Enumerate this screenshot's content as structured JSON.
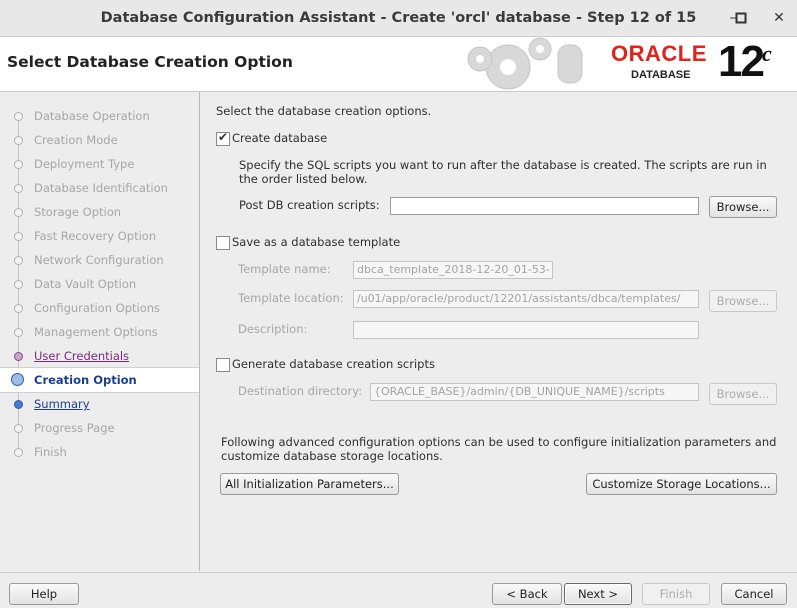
{
  "window": {
    "title": "Database Configuration Assistant - Create 'orcl' database - Step 12 of 15",
    "minimize_glyph": "–",
    "maximize_glyph": "□",
    "close_glyph": "✕"
  },
  "header": {
    "page_title": "Select Database Creation Option",
    "brand_oracle": "ORACLE",
    "brand_database": "DATABASE",
    "brand_version": "12",
    "brand_version_suffix": "c"
  },
  "sidebar": {
    "steps": [
      {
        "label": "Database Operation",
        "state": "done"
      },
      {
        "label": "Creation Mode",
        "state": "done"
      },
      {
        "label": "Deployment Type",
        "state": "done"
      },
      {
        "label": "Database Identification",
        "state": "done"
      },
      {
        "label": "Storage Option",
        "state": "done"
      },
      {
        "label": "Fast Recovery Option",
        "state": "done"
      },
      {
        "label": "Network Configuration",
        "state": "done"
      },
      {
        "label": "Data Vault Option",
        "state": "done"
      },
      {
        "label": "Configuration Options",
        "state": "done"
      },
      {
        "label": "Management Options",
        "state": "done"
      },
      {
        "label": "User Credentials",
        "state": "link"
      },
      {
        "label": "Creation Option",
        "state": "current"
      },
      {
        "label": "Summary",
        "state": "next"
      },
      {
        "label": "Progress Page",
        "state": "pending"
      },
      {
        "label": "Finish",
        "state": "pending"
      }
    ]
  },
  "main": {
    "intro": "Select the database creation options.",
    "create_db": {
      "label": "Create database",
      "checked": true,
      "desc_line1": "Specify the SQL scripts you want to run after the database is created. The scripts are run in",
      "desc_line2": "the order listed below.",
      "post_scripts_label": "Post DB creation scripts:",
      "post_scripts_value": "",
      "browse_label": "Browse..."
    },
    "template": {
      "label": "Save as a database template",
      "checked": false,
      "name_label": "Template name:",
      "name_value": "dbca_template_2018-12-20_01-53-",
      "location_label": "Template location:",
      "location_value": "/u01/app/oracle/product/12201/assistants/dbca/templates/",
      "browse_label": "Browse...",
      "description_label": "Description:",
      "description_value": ""
    },
    "scripts": {
      "label": "Generate database creation scripts",
      "checked": false,
      "dest_label": "Destination directory:",
      "dest_value": "{ORACLE_BASE}/admin/{DB_UNIQUE_NAME}/scripts",
      "browse_label": "Browse..."
    },
    "advanced_line1": "Following advanced configuration options can be used to configure initialization parameters and",
    "advanced_line2": "customize database storage locations.",
    "init_params_button": "All Initialization Parameters...",
    "storage_button": "Customize Storage Locations..."
  },
  "footer": {
    "help": "Help",
    "back": "< Back",
    "next": "Next >",
    "finish": "Finish",
    "cancel": "Cancel"
  },
  "colors": {
    "oracle_red": "#e2231a",
    "link_purple": "#7a2a7a",
    "link_blue": "#1b3f8f"
  }
}
